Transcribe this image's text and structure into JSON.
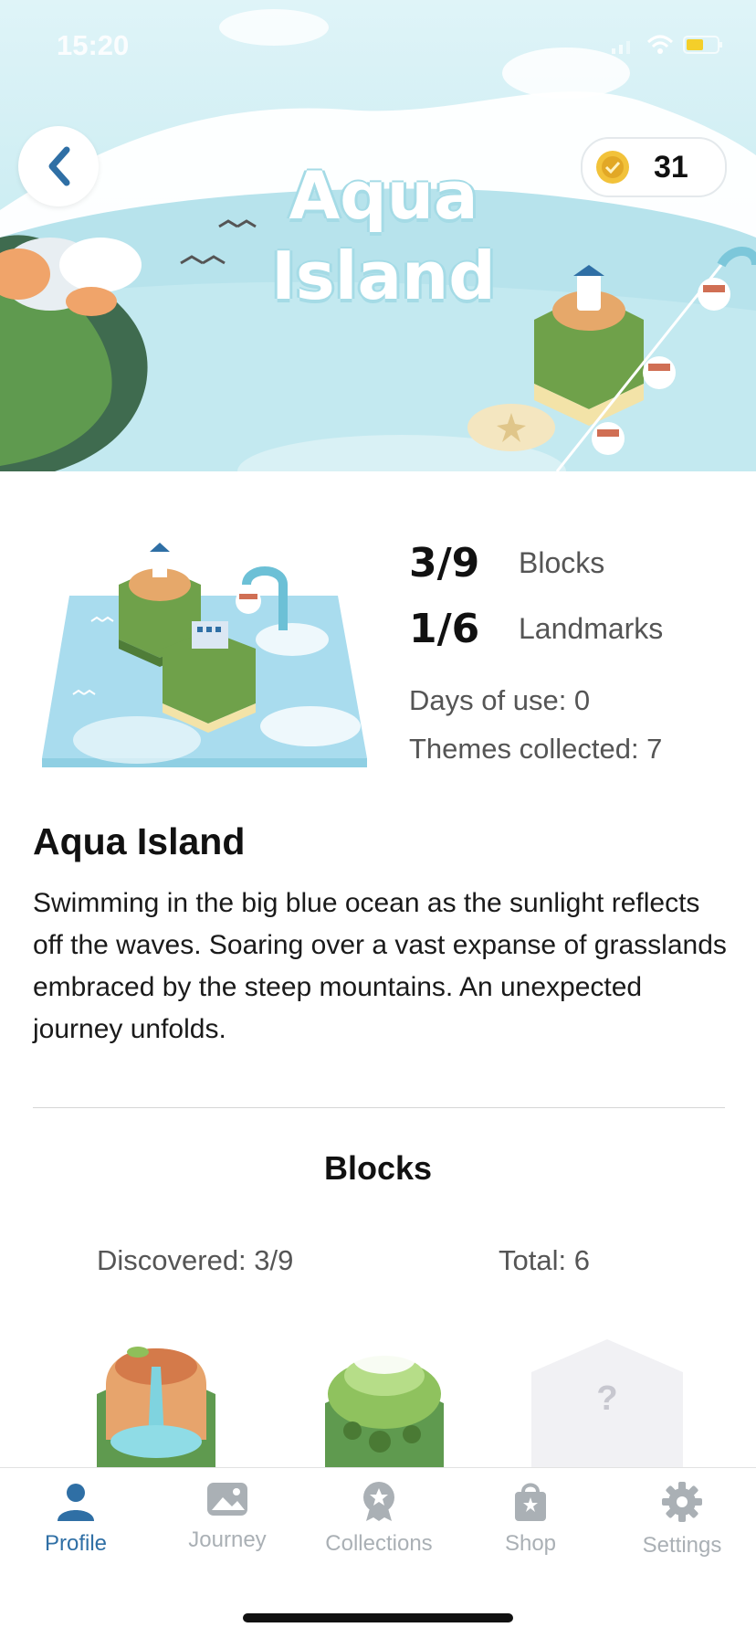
{
  "status_bar": {
    "time": "15:20"
  },
  "header": {
    "title_line1": "Aqua",
    "title_line2": "Island",
    "coin_count": "31",
    "accent": "#2f6fa5",
    "coin_color": "#f2c23a"
  },
  "stats": {
    "blocks_value": "3/9",
    "blocks_label": "Blocks",
    "landmarks_value": "1/6",
    "landmarks_label": "Landmarks",
    "days_of_use": "Days of use: 0",
    "themes_collected": "Themes collected: 7"
  },
  "description": {
    "title": "Aqua Island",
    "body": "Swimming in the big blue ocean as the sunlight reflects off the waves. Soaring over a vast expanse of grasslands embraced by the steep mountains. An unexpected journey unfolds."
  },
  "blocks_section": {
    "heading": "Blocks",
    "discovered": "Discovered:  3/9",
    "total": "Total:  6",
    "tiles": [
      {
        "name": "waterfall-block",
        "locked": false
      },
      {
        "name": "grass-hill-block",
        "locked": false
      },
      {
        "name": "unknown-block",
        "locked": true,
        "symbol": "?"
      }
    ]
  },
  "tabbar": {
    "tabs": [
      {
        "label": "Profile",
        "icon": "person-icon",
        "active": true
      },
      {
        "label": "Journey",
        "icon": "image-icon",
        "active": false
      },
      {
        "label": "Collections",
        "icon": "badge-icon",
        "active": false
      },
      {
        "label": "Shop",
        "icon": "shopping-bag-icon",
        "active": false
      },
      {
        "label": "Settings",
        "icon": "gear-icon",
        "active": false
      }
    ]
  }
}
